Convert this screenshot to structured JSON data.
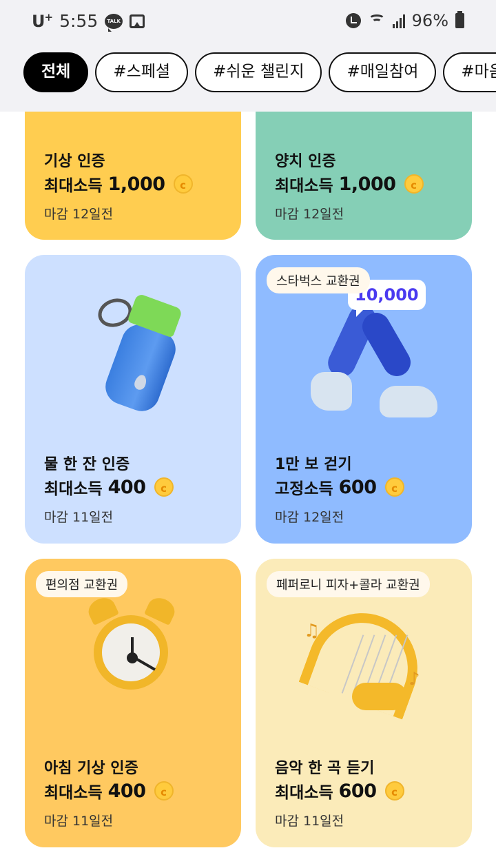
{
  "status_bar": {
    "carrier": "U",
    "carrier_plus": "+",
    "time": "5:55",
    "talk_icon_text": "TALK",
    "battery": "96%"
  },
  "filters": [
    {
      "label": "전체",
      "active": true
    },
    {
      "label": "#스페셜",
      "active": false
    },
    {
      "label": "#쉬운 챌린지",
      "active": false
    },
    {
      "label": "#매일참여",
      "active": false
    },
    {
      "label": "#마음 실",
      "active": false
    }
  ],
  "cards": [
    {
      "title": "기상 인증",
      "reward_label": "최대소득",
      "reward_amount": "1,000",
      "deadline": "마감 12일전"
    },
    {
      "title": "양치 인증",
      "reward_label": "최대소득",
      "reward_amount": "1,000",
      "deadline": "마감 12일전"
    },
    {
      "title": "물 한 잔 인증",
      "reward_label": "최대소득",
      "reward_amount": "400",
      "deadline": "마감 11일전"
    },
    {
      "title": "1만 보 걷기",
      "reward_label": "고정소득",
      "reward_amount": "600",
      "deadline": "마감 12일전",
      "badge": "스타벅스 교환권",
      "bubble": "10,000"
    },
    {
      "title": "아침 기상 인증",
      "reward_label": "최대소득",
      "reward_amount": "400",
      "deadline": "마감 11일전",
      "badge": "편의점 교환권"
    },
    {
      "title": "음악 한 곡 듣기",
      "reward_label": "최대소득",
      "reward_amount": "600",
      "deadline": "마감 11일전",
      "badge": "페퍼로니 피자+콜라 교환권"
    }
  ],
  "coin_symbol": "c",
  "colors": {
    "card_yellow": "#ffcd50",
    "card_green": "#85cfb6",
    "card_light_blue": "#cde0ff",
    "card_blue": "#8fbbff",
    "card_orange": "#ffc960",
    "card_cream": "#fbebb9",
    "coin": "#ffcb3d",
    "chip_active": "#000000"
  }
}
